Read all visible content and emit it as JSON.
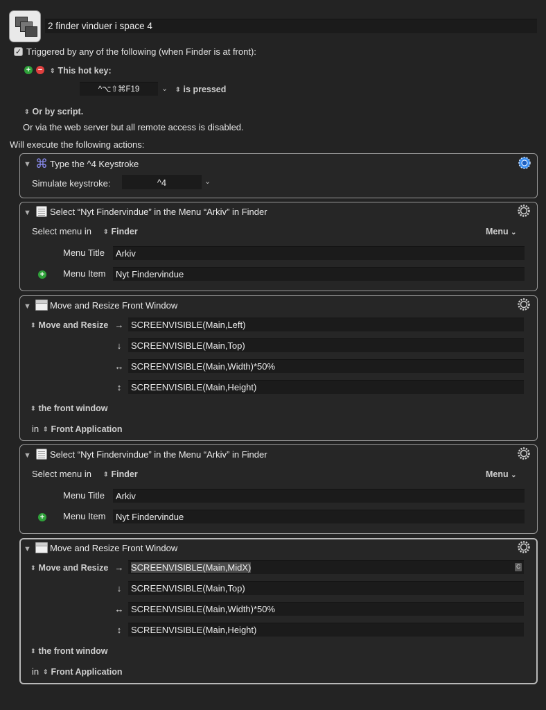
{
  "macro": {
    "name": "2 finder vinduer i space 4",
    "trigger_checkbox_label": "Triggered by any of the following (when Finder is at front):",
    "hotkey_section_label": "This hot key:",
    "hotkey_value": "^⌥⇧⌘F19",
    "hotkey_mode": "is pressed",
    "script_label": "Or by script.",
    "web_server_note": "Or via the web server but all remote access is disabled.",
    "actions_header": "Will execute the following actions:"
  },
  "actions": [
    {
      "title": "Type the ^4 Keystroke",
      "simulate_label": "Simulate keystroke:",
      "keystroke": "^4"
    },
    {
      "title": "Select “Nyt Findervindue” in the Menu “Arkiv” in Finder",
      "select_menu_label": "Select menu in",
      "app": "Finder",
      "menu_popup": "Menu",
      "menu_title_label": "Menu Title",
      "menu_title_value": "Arkiv",
      "menu_item_label": "Menu Item",
      "menu_item_value": "Nyt Findervindue"
    },
    {
      "title": "Move and Resize Front Window",
      "mode": "Move and Resize",
      "left": "SCREENVISIBLE(Main,Left)",
      "top": "SCREENVISIBLE(Main,Top)",
      "width": "SCREENVISIBLE(Main,Width)*50%",
      "height": "SCREENVISIBLE(Main,Height)",
      "window_target": "the front window",
      "in_label": "in",
      "app_target": "Front Application"
    },
    {
      "title": "Select “Nyt Findervindue” in the Menu “Arkiv” in Finder",
      "select_menu_label": "Select menu in",
      "app": "Finder",
      "menu_popup": "Menu",
      "menu_title_label": "Menu Title",
      "menu_title_value": "Arkiv",
      "menu_item_label": "Menu Item",
      "menu_item_value": "Nyt Findervindue"
    },
    {
      "title": "Move and Resize Front Window",
      "mode": "Move and Resize",
      "left": "SCREENVISIBLE(Main,MidX)",
      "top": "SCREENVISIBLE(Main,Top)",
      "width": "SCREENVISIBLE(Main,Width)*50%",
      "height": "SCREENVISIBLE(Main,Height)",
      "window_target": "the front window",
      "in_label": "in",
      "app_target": "Front Application",
      "field_badge": "C"
    }
  ],
  "colors": {
    "background": "#232323",
    "gear_active": "#3b8ff0",
    "add_green": "#2fa13a",
    "remove_red": "#e0403f"
  },
  "icons": {
    "macro": "macro-windows-icon",
    "keystroke": "command-key-icon",
    "menu": "menu-icon",
    "window": "window-icon",
    "gear": "gear-icon"
  }
}
